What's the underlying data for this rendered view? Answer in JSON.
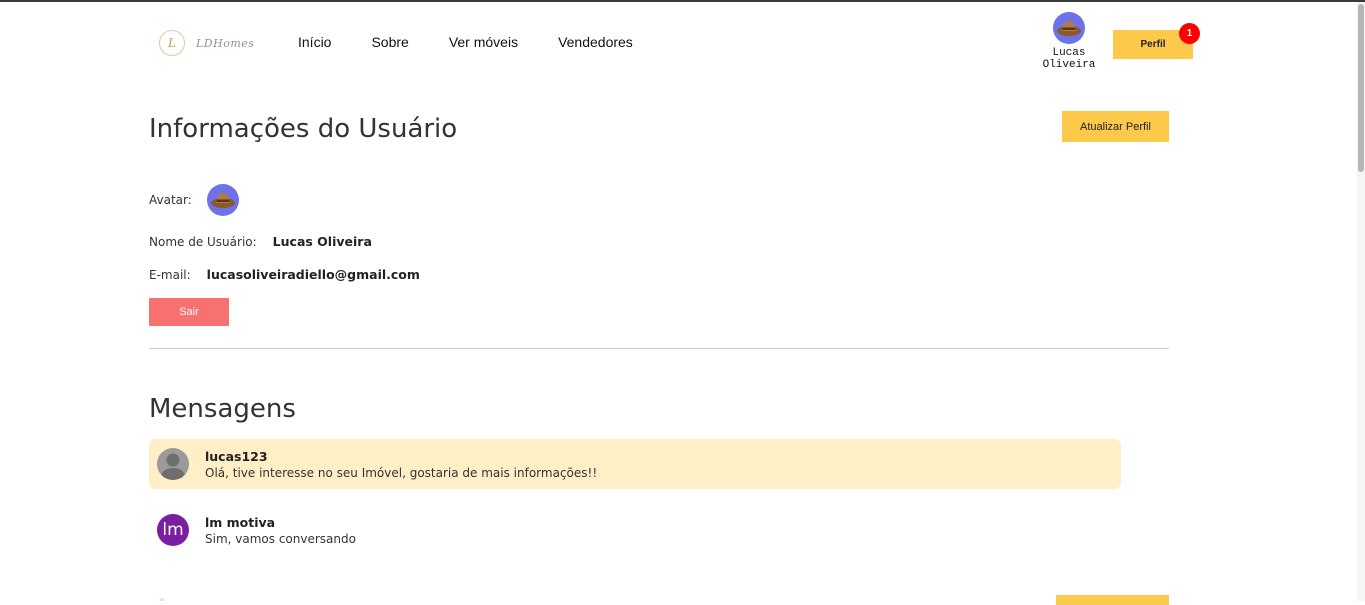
{
  "header": {
    "logo_mark": "L",
    "logo_text": "LDHomes",
    "nav": [
      "Início",
      "Sobre",
      "Ver móveis",
      "Vendedores"
    ],
    "user_name_line1": "Lucas",
    "user_name_line2": "Oliveira",
    "profile_button": "Perfil",
    "notification_count": "1"
  },
  "user_info": {
    "title": "Informações do Usuário",
    "update_button": "Atualizar Perfil",
    "avatar_label": "Avatar:",
    "username_label": "Nome de Usuário:",
    "username_value": "Lucas Oliveira",
    "email_label": "E-mail:",
    "email_value": "lucasoliveiradiello@gmail.com",
    "logout_button": "Sair"
  },
  "messages": {
    "title": "Mensagens",
    "items": [
      {
        "sender": "lucas123",
        "text": "Olá, tive interesse no seu Imóvel, gostaria de mais informações!!",
        "avatar": "default-user"
      },
      {
        "sender": "lm motiva",
        "text": "Sim, vamos conversando",
        "avatar_initials": "lm"
      }
    ]
  },
  "colors": {
    "accent": "#fcc94a",
    "danger": "#f87171",
    "badge": "#ff0000",
    "highlight": "#feefc6",
    "avatar_bg": "#6d72e8",
    "initials_bg": "#7b1fa2"
  }
}
